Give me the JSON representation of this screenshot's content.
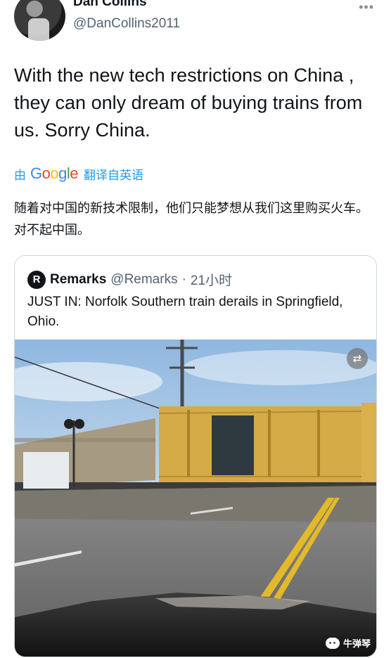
{
  "author": {
    "display_name": "Dan Collins",
    "handle": "@DanCollins2011",
    "more_icon": "more-horizontal-icon"
  },
  "tweet": {
    "text": "With the new tech restrictions on China , they can only dream of buying trains from us. Sorry China."
  },
  "translation": {
    "by_label": "由",
    "google_letters": [
      "G",
      "o",
      "o",
      "g",
      "l",
      "e"
    ],
    "translated_from_label": "翻译自英语",
    "translated_text": "随着对中国的新技术限制，他们只能梦想从我们这里购买火车。对不起中国。"
  },
  "quoted_tweet": {
    "avatar_letter": "R",
    "display_name": "Remarks",
    "handle": "@Remarks",
    "separator": "·",
    "time": "21小时",
    "text": "JUST IN: Norfolk Southern train derails in Springfield, Ohio.",
    "media_badge_icon": "gif-badge-icon"
  },
  "watermark": {
    "text": "牛弹琴",
    "icon": "wechat-icon"
  },
  "colors": {
    "link_blue": "#1d9bf0",
    "secondary_text": "#536471",
    "google_blue": "#4285f4",
    "google_red": "#ea4335",
    "google_yellow": "#fbbc05",
    "google_green": "#34a853"
  }
}
